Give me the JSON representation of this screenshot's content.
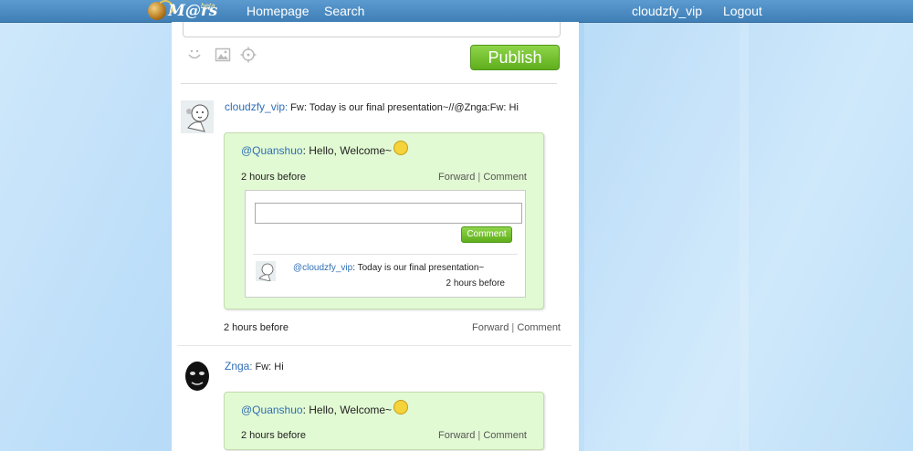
{
  "nav": {
    "logo_text": "M@rs",
    "logo_beta": "beta",
    "homepage": "Homepage",
    "search": "Search",
    "username": "cloudzfy_vip",
    "logout": "Logout"
  },
  "compose": {
    "publish_label": "Publish",
    "icons": [
      "smiley-icon",
      "image-icon",
      "location-icon"
    ]
  },
  "posts": [
    {
      "user": "cloudzfy_vip",
      "text": "Fw: Today is our final presentation~//@Znga:Fw: Hi",
      "repost": {
        "user": "@Quanshuo",
        "text": "Hello, Welcome~",
        "time": "2 hours before",
        "forward": "Forward",
        "sep": "|",
        "comment": "Comment"
      },
      "comment_panel": {
        "input_value": "",
        "button": "Comment",
        "entry": {
          "user": "@cloudzfy_vip",
          "text": "Today is our final presentation~",
          "time": "2 hours before"
        }
      },
      "time": "2 hours before",
      "forward": "Forward",
      "sep": "|",
      "comment": "Comment"
    },
    {
      "user": "Znga",
      "text": "Fw: Hi",
      "repost": {
        "user": "@Quanshuo",
        "text": "Hello, Welcome~",
        "time": "2 hours before",
        "forward": "Forward",
        "sep": "|",
        "comment": "Comment"
      }
    }
  ],
  "colors": {
    "topbar": "#4a8cc4",
    "accent_green": "#6bbf26",
    "card_green": "#e2fad3",
    "link_blue": "#2f6eb5"
  }
}
